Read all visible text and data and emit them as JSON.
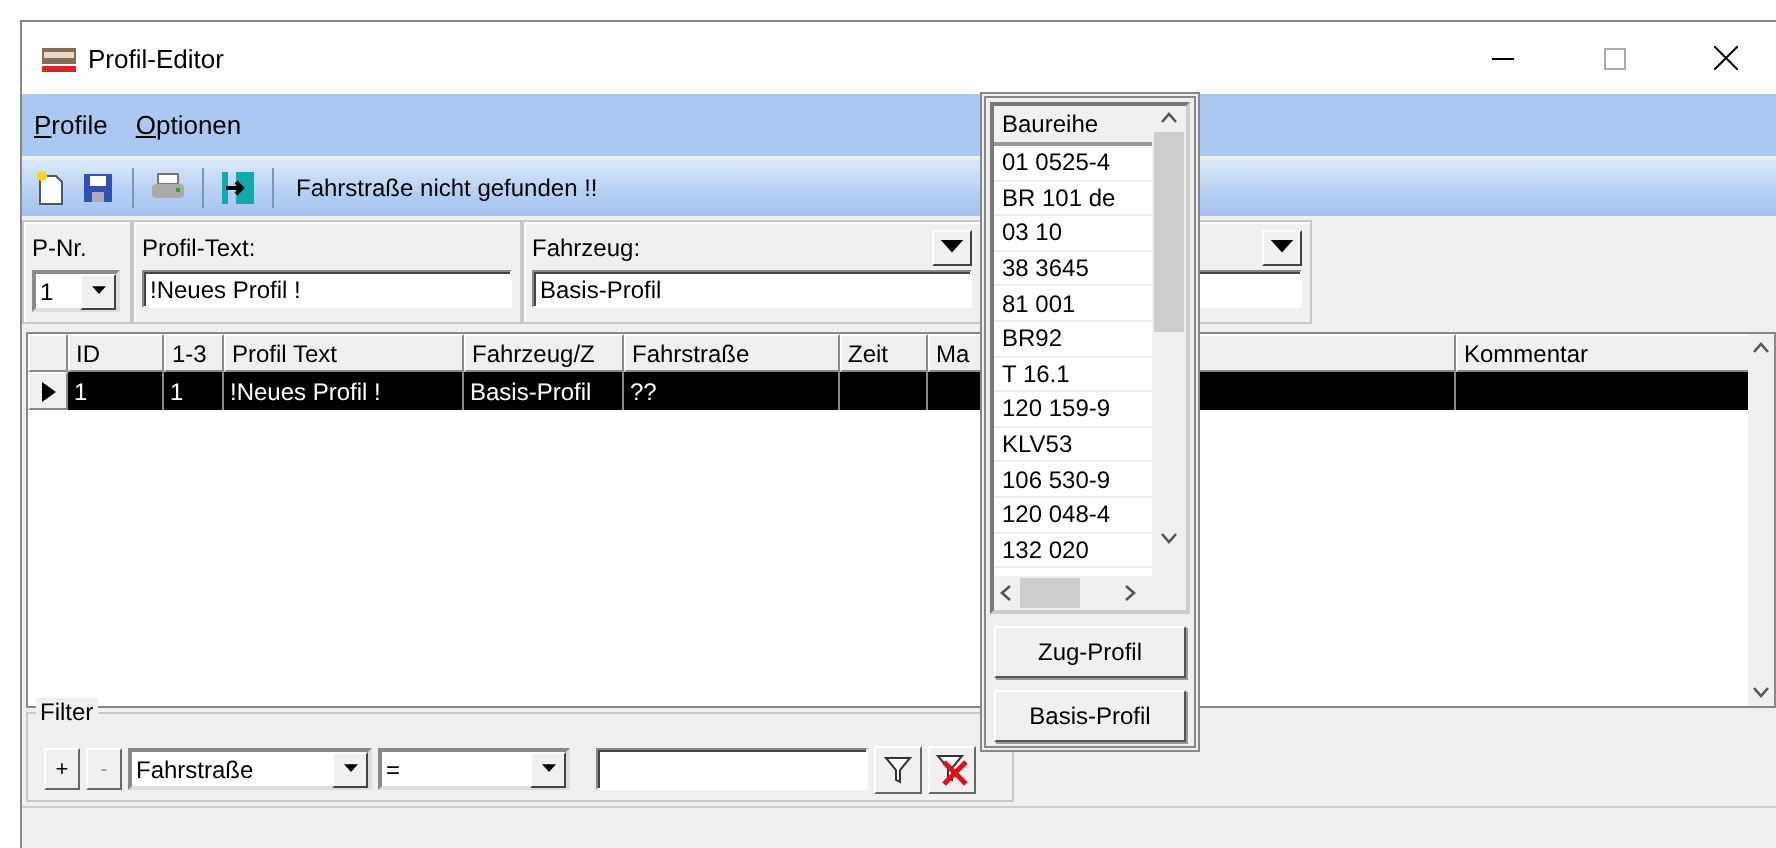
{
  "window": {
    "title": "Profil-Editor"
  },
  "menu": [
    {
      "label": "Profile"
    },
    {
      "label": "Optionen"
    }
  ],
  "toolbar": {
    "message": "Fahrstraße nicht gefunden !!"
  },
  "profile_panel": {
    "p_nr": {
      "label": "P-Nr.",
      "value": "1"
    },
    "profil_text": {
      "label": "Profil-Text:",
      "value": "!Neues Profil !"
    },
    "fahrzeug": {
      "label": "Fahrzeug:",
      "value": "Basis-Profil"
    }
  },
  "table": {
    "columns": [
      "ID",
      "1-3",
      "Profil Text",
      "Fahrzeug/Z",
      "Fahrstraße",
      "Zeit",
      "Ma",
      "Kommentar"
    ],
    "rows": [
      {
        "selected": true,
        "cells": [
          "1",
          "1",
          "!Neues Profil !",
          "Basis-Profil",
          "??"
        ]
      }
    ]
  },
  "filter": {
    "title": "Filter",
    "add": "+",
    "remove": "-",
    "field": "Fahrstraße",
    "operator": "="
  },
  "dropdown": {
    "header": "Baureihe",
    "items": [
      "01 0525-4",
      "BR 101 de",
      "03 10",
      "38 3645",
      "81 001",
      "BR92",
      "T 16.1",
      "120 159-9",
      "KLV53",
      "106 530-9",
      "120 048-4",
      "132 020"
    ],
    "buttons": [
      "Zug-Profil",
      "Basis-Profil"
    ]
  }
}
